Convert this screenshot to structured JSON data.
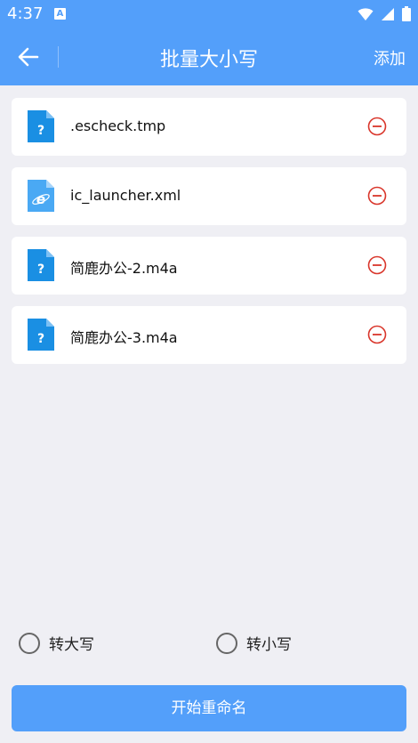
{
  "status": {
    "time": "4:37",
    "notification_icon": "a-letter-icon",
    "icons": [
      "wifi-icon",
      "signal-icon",
      "battery-icon"
    ]
  },
  "appbar": {
    "title": "批量大小写",
    "add_label": "添加",
    "back_icon": "arrow-left-icon"
  },
  "files": [
    {
      "name": ".escheck.tmp",
      "icon": "unknown-file-icon"
    },
    {
      "name": "ic_launcher.xml",
      "icon": "ie-file-icon"
    },
    {
      "name": "简鹿办公-2.m4a",
      "icon": "unknown-file-icon"
    },
    {
      "name": "简鹿办公-3.m4a",
      "icon": "unknown-file-icon"
    }
  ],
  "options": {
    "uppercase_label": "转大写",
    "lowercase_label": "转小写"
  },
  "action": {
    "start_label": "开始重命名"
  },
  "colors": {
    "primary": "#539ffa",
    "remove": "#d9362b",
    "background": "#efeff4"
  }
}
